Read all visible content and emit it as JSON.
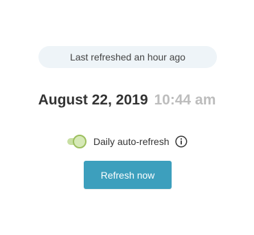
{
  "status": {
    "last_refreshed": "Last refreshed an hour ago"
  },
  "timestamp": {
    "date": "August 22, 2019",
    "time": "10:44 am"
  },
  "auto_refresh": {
    "label": "Daily auto-refresh",
    "enabled": true,
    "info_icon": "info-circle-icon"
  },
  "actions": {
    "refresh_now_label": "Refresh now"
  },
  "colors": {
    "button_bg": "#3d9fbd",
    "toggle_on": "#c8dfa3",
    "pill_bg": "#eef4f8",
    "time_gray": "#bdbdbd"
  }
}
